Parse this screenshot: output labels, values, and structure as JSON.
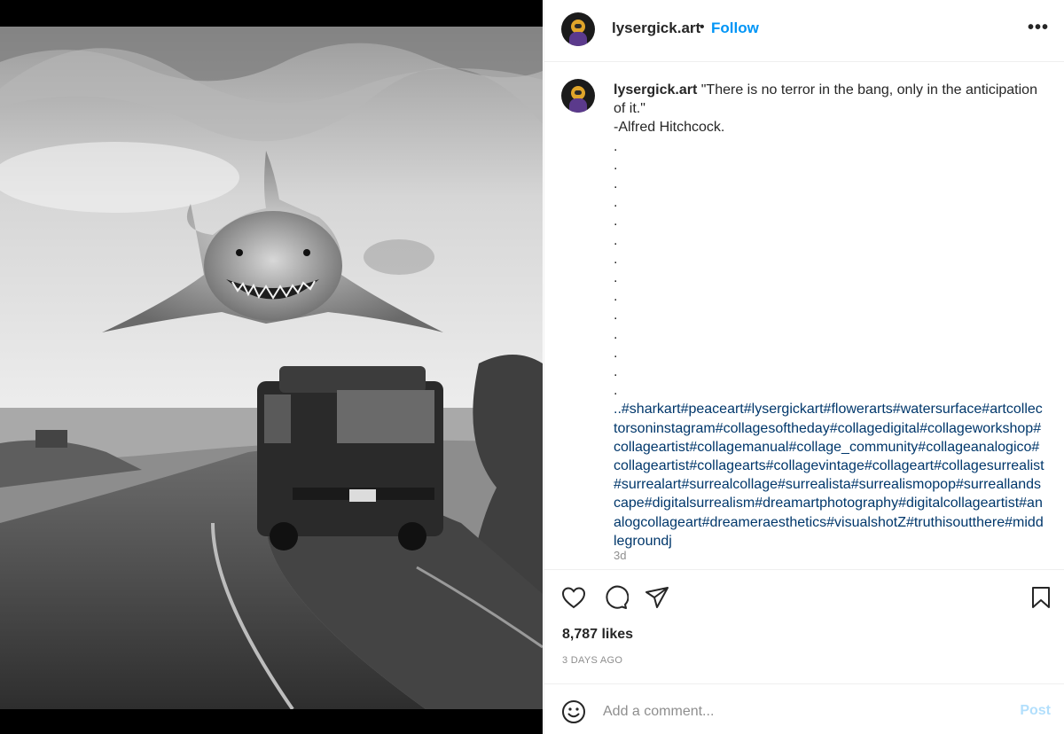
{
  "post": {
    "username": "lysergick.art",
    "separator": "•",
    "follow_label": "Follow",
    "more_label": "•••",
    "caption_text": "\"There is no terror in the bang, only in the anticipation of it.\"\n-Alfred Hitchcock.\n.\n.\n.\n.\n.\n.\n.\n.\n.\n.\n.\n.\n.\n.",
    "hashtags": "..#sharkart#peaceart#lysergickart#flowerarts#watersurface#artcollectorsoninstagram#collagesoftheday#collagedigital#collageworkshop#collageartist#collagemanual#collage_community#collageanalogico#collageartist#collagearts#collagevintage#collageart#collagesurrealist#surrealart#surrealcollage#surrealista#surrealismopop#surreallandscape#digitalsurrealism#dreamartphotography#digitalcollageartist#analogcollageart#dreameraesthetics#visualshotZ#truthisoutthere#middlegroundj",
    "age": "3d",
    "likes": "8,787 likes",
    "date": "3 DAYS AGO",
    "comment_placeholder": "Add a comment...",
    "post_label": "Post"
  },
  "icons": {
    "like": "heart-icon",
    "comment": "comment-icon",
    "share": "paper-plane-icon",
    "save": "bookmark-icon",
    "emoji": "smiley-icon",
    "more": "ellipsis-icon"
  },
  "colors": {
    "link_blue": "#0095f6",
    "hashtag_blue": "#00376b",
    "muted_gray": "#8e8e8e",
    "text": "#262626",
    "post_disabled": "#b2dffc"
  }
}
